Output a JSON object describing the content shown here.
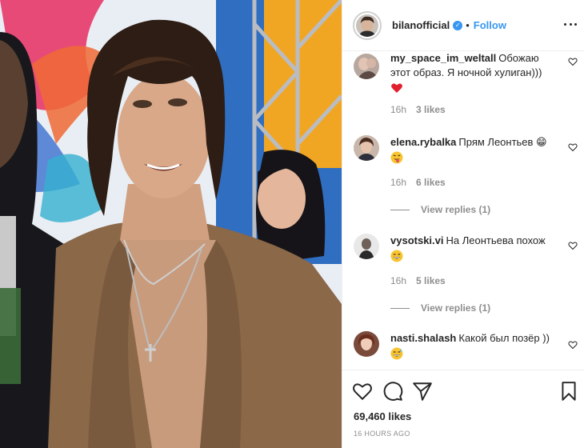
{
  "header": {
    "username": "bilanofficial",
    "verified": true,
    "separator": "•",
    "follow_label": "Follow",
    "more_icon": "more-horizontal-icon"
  },
  "comments": [
    {
      "username": "my_space_im_weltall",
      "text": "Обожаю этот образ. Я ночной хулиган)))",
      "emoji": "red-heart",
      "time": "16h",
      "likes": "3 likes",
      "view_replies": ""
    },
    {
      "username": "elena.rybalka",
      "text": "Прям Леонтьев 😁",
      "emoji": "tongue-face",
      "time": "16h",
      "likes": "6 likes",
      "view_replies": "View replies (1)"
    },
    {
      "username": "vysotski.vi",
      "text": "На Леонтьева похож",
      "emoji": "grin-face",
      "time": "16h",
      "likes": "5 likes",
      "view_replies": "View replies (1)"
    },
    {
      "username": "nasti.shalash",
      "text": "Какой был позёр ))",
      "emoji": "grin-sweat-face",
      "time": "",
      "likes": "",
      "view_replies": ""
    }
  ],
  "actions": {
    "likes_count": "69,460 likes",
    "timestamp": "16 HOURS AGO"
  },
  "colors": {
    "accent": "#3897f0",
    "text": "#262626",
    "muted": "#8e8e8e",
    "heart": "#ed4956"
  }
}
